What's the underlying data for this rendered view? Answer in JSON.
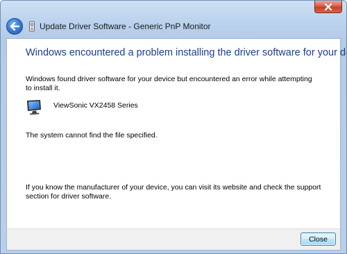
{
  "window": {
    "title": "Update Driver Software - Generic PnP Monitor"
  },
  "content": {
    "heading": "Windows encountered a problem installing the driver software for your device",
    "found_text": "Windows found driver software for your device but encountered an error while attempting to install it.",
    "device_name": "ViewSonic VX2458 Series",
    "error_text": "The system cannot find the file specified.",
    "help_text": "If you know the manufacturer of your device, you can visit its website and check the support section for driver software."
  },
  "footer": {
    "close_label": "Close"
  },
  "icons": {
    "window_close": "close-icon",
    "back": "back-arrow-icon",
    "title_device": "device-icon",
    "device": "monitor-icon"
  },
  "colors": {
    "heading": "#1c3b8a",
    "frame": "#b9cfe9",
    "close_red": "#c7432b",
    "button_border": "#3c7fb1"
  }
}
